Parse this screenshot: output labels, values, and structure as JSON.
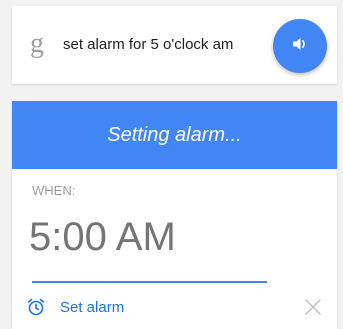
{
  "search": {
    "logo": "g",
    "query": "set alarm for 5 o'clock am",
    "voice_icon": "speaker-icon"
  },
  "alarm": {
    "banner_text": "Setting alarm...",
    "when_label": "WHEN:",
    "time": "5:00 AM",
    "action_label": "Set alarm",
    "action_icon": "alarm-clock-icon",
    "close_icon": "close-icon"
  },
  "colors": {
    "accent": "#4285f4",
    "background": "#f2f2f2",
    "muted_text": "#9e9e9e"
  }
}
